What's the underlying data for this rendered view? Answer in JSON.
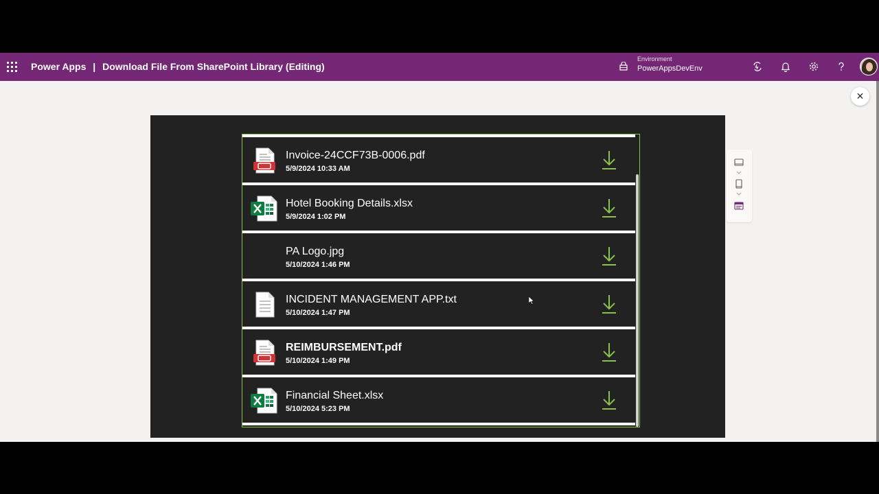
{
  "header": {
    "app_name": "Power Apps",
    "separator": "|",
    "doc_title": "Download File From SharePoint Library (Editing)",
    "environment_label": "Environment",
    "environment_name": "PowerAppsDevEnv",
    "bg_color": "#742774"
  },
  "gallery": {
    "accent_color": "#8bc34a",
    "items": [
      {
        "name": "Invoice-24CCF73B-0006.pdf",
        "date": "5/9/2024 10:33 AM",
        "icon": "pdf-file-icon"
      },
      {
        "name": "Hotel Booking Details.xlsx",
        "date": "5/9/2024 1:02 PM",
        "icon": "excel-file-icon"
      },
      {
        "name": "PA Logo.jpg",
        "date": "5/10/2024 1:46 PM",
        "icon": "none"
      },
      {
        "name": "INCIDENT MANAGEMENT APP.txt",
        "date": "5/10/2024 1:47 PM",
        "icon": "text-file-icon"
      },
      {
        "name": "REIMBURSEMENT.pdf",
        "date": "5/10/2024 1:49 PM",
        "icon": "pdf-file-icon"
      },
      {
        "name": "Financial Sheet.xlsx",
        "date": "5/10/2024 5:23 PM",
        "icon": "excel-file-icon"
      }
    ]
  },
  "close_button": {
    "symbol": "✕"
  }
}
